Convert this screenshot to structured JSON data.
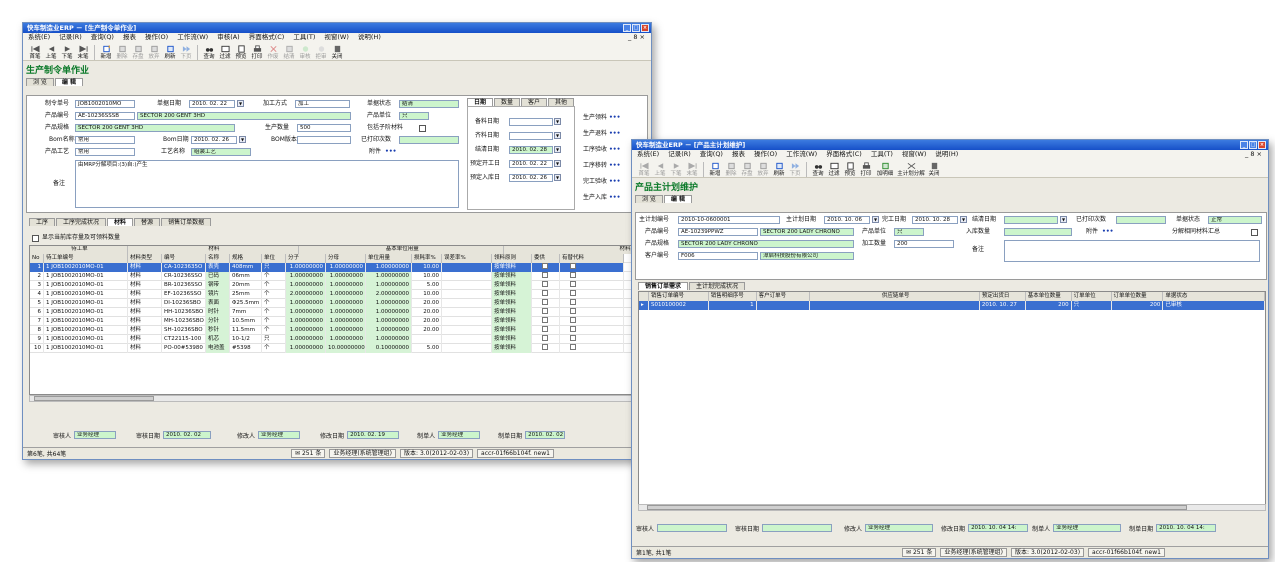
{
  "w1": {
    "title": "快车制造业ERP － [生产制令单作业]",
    "menu": [
      "系统(E)",
      "记录(R)",
      "查询(Q)",
      "报表",
      "操作(O)",
      "工作流(W)",
      "审核(A)",
      "界面格式(C)",
      "工具(T)",
      "视窗(W)",
      "说明(H)"
    ],
    "menu_right": "_ 8 ×",
    "toolbar": [
      "首笔",
      "上笔",
      "下笔",
      "末笔",
      "新增",
      "删除",
      "存盘",
      "放弃",
      "刷新",
      "下页",
      "查询",
      "过滤",
      "预览",
      "打印",
      "作废",
      "结清",
      "审核",
      "拒审",
      "关闭"
    ],
    "form_title": "生产制令单作业",
    "view_tabs": [
      "浏 览",
      "编 辑"
    ],
    "f": {
      "l_no": "制令单号",
      "no": "JOB1002010MO",
      "l_date": "单据日期",
      "date": "2010. 02. 22",
      "l_method": "加工方式",
      "method": "加工",
      "l_status": "单据状态",
      "status": "结清",
      "l_pcode": "产品编号",
      "pcode": "AE-10236SSSB",
      "pname": "SECTOR 200 GENT 3HD",
      "l_unit": "产品单位",
      "unit": "只",
      "l_spec": "产品规格",
      "spec": "SECTOR 200 GENT 3HD",
      "l_qty": "生产数量",
      "qty": "500",
      "l_incl": "包括子阶材料",
      "l_bom": "Bom名称",
      "bom": "常用",
      "l_bomdate": "Bom日期",
      "bomdate": "2010. 02. 26",
      "l_bomver": "BOM版本",
      "l_printed": "已打印次数",
      "l_proc": "产品工艺",
      "proc": "常用",
      "l_procname": "工艺名称",
      "procname": "组装工艺",
      "l_attach": "附件",
      "attach": "•••",
      "memo": "由MRP分解项目:(3)自:)产生",
      "l_memo": "备注"
    },
    "rtabs": [
      "日期",
      "数量",
      "客户",
      "其他"
    ],
    "r": {
      "l_prep": "备料日期",
      "l_reqdate": "齐料日期",
      "l_close": "结清日期",
      "close": "2010. 02. 28",
      "l_pstart": "预定开工日",
      "pstart": "2010. 02. 22",
      "l_pin": "预定入库日",
      "pin": "2010. 02. 26"
    },
    "links": [
      "生产领料",
      "生产退料",
      "工序验收",
      "工序移转",
      "完工验收",
      "生产入库"
    ],
    "link_dots": "•••",
    "btabs": [
      "工序",
      "工序完成状况",
      "材料",
      "替源",
      "销售订单数据"
    ],
    "show_stock": "显示当前库存量及可领料数量",
    "grid_groups": [
      "待工单",
      "材料",
      "基本单位用量",
      "材料其他属"
    ],
    "cols": [
      "No",
      "待工单编号",
      "材料类型",
      "编号",
      "名称",
      "规格",
      "单位",
      "分子",
      "分母",
      "单位用量",
      "损耗率%",
      "误差率%",
      "领料原则",
      "委供",
      "有替代料"
    ],
    "rows": [
      [
        "1",
        "1 JOB1002010MO-01",
        "材料",
        "CA-1023635O",
        "表壳",
        "408mm",
        "只",
        "1.00000000",
        "1.00000000",
        "1.00000000",
        "10.00",
        "",
        "按单领料"
      ],
      [
        "2",
        "1 JOB1002010MO-01",
        "材料",
        "CR-10236SSO",
        "已码",
        "06mm",
        "个",
        "1.00000000",
        "1.00000000",
        "1.00000000",
        "10.00",
        "",
        "按单领料"
      ],
      [
        "3",
        "1 JOB1002010MO-01",
        "材料",
        "BR-10236SSO",
        "钢带",
        "20mm",
        "个",
        "1.00000000",
        "1.00000000",
        "1.00000000",
        "5.00",
        "",
        "按单领料"
      ],
      [
        "4",
        "1 JOB1002010MO-01",
        "材料",
        "EF-10236SSO",
        "镜片",
        "25mm",
        "个",
        "2.00000000",
        "1.00000000",
        "2.00000000",
        "10.00",
        "",
        "按单领料"
      ],
      [
        "5",
        "1 JOB1002010MO-01",
        "材料",
        "DI-10236SBO",
        "表面",
        "Φ25.5mm",
        "个",
        "1.00000000",
        "1.00000000",
        "1.00000000",
        "20.00",
        "",
        "按单领料"
      ],
      [
        "6",
        "1 JOB1002010MO-01",
        "材料",
        "HH-10236SBO",
        "时针",
        "7mm",
        "个",
        "1.00000000",
        "1.00000000",
        "1.00000000",
        "20.00",
        "",
        "按单领料"
      ],
      [
        "7",
        "1 JOB1002010MO-01",
        "材料",
        "MH-10236SBO",
        "分针",
        "10.5mm",
        "个",
        "1.00000000",
        "1.00000000",
        "1.00000000",
        "20.00",
        "",
        "按单领料"
      ],
      [
        "8",
        "1 JOB1002010MO-01",
        "材料",
        "SH-10236SBO",
        "秒针",
        "11.5mm",
        "个",
        "1.00000000",
        "1.00000000",
        "1.00000000",
        "20.00",
        "",
        "按单领料"
      ],
      [
        "9",
        "1 JOB1002010MO-01",
        "材料",
        "CT22115-100",
        "机芯",
        "10-1/2",
        "只",
        "1.00000000",
        "1.00000000",
        "1.00000000",
        "",
        "",
        "按单领料"
      ],
      [
        "10",
        "1 JOB1002010MO-01",
        "材料",
        "PO-00#53980",
        "电池盖",
        "#5398",
        "个",
        "1.00000000",
        "10.00000000",
        "0.10000000",
        "5.00",
        "",
        "按单领料"
      ]
    ],
    "foot": {
      "l_auditor": "审核人",
      "auditor": "业务经理",
      "l_auditdate": "审核日期",
      "auditdate": "2010. 02. 02",
      "l_mod": "修改人",
      "mod": "业务经理",
      "l_moddate": "修改日期",
      "moddate": "2010. 02. 19",
      "l_maker": "制单人",
      "maker": "业务经理",
      "l_makedate": "制单日期",
      "makedate": "2010. 02. 02"
    },
    "status": {
      "left": "第6笔, 共64笔",
      "count": "251 条",
      "user": "业务经理(系统管理组)",
      "ver": "版本: 3.0(2012-02-03)",
      "db": "accr-01f66b104f. new1"
    }
  },
  "w2": {
    "title": "快车制造业ERP － [产品主计划维护]",
    "menu": [
      "系统(E)",
      "记录(R)",
      "查询(Q)",
      "报表",
      "操作(O)",
      "工作流(W)",
      "界面格式(C)",
      "工具(T)",
      "视窗(W)",
      "说明(H)"
    ],
    "menu_right": "_ 8 ×",
    "toolbar": [
      "首笔",
      "上笔",
      "下笔",
      "末笔",
      "新增",
      "删除",
      "存盘",
      "放弃",
      "刷新",
      "下页",
      "查询",
      "过滤",
      "预览",
      "打印",
      "加明细",
      "主计划分解",
      "关闭"
    ],
    "form_title": "产品主计划维护",
    "view_tabs": [
      "浏 览",
      "编 辑"
    ],
    "f": {
      "l_plan": "主计划编号",
      "plan": "2010-10-0600001",
      "l_pdate": "主计划日期",
      "pdate": "2010. 10. 06",
      "l_done": "完工日期",
      "done": "2010. 10. 28",
      "l_close": "结清日期",
      "l_printed": "已打印次数",
      "l_status": "单据状态",
      "status": "正常",
      "l_pcode": "产品编号",
      "pcode": "AE-10239PPWZ",
      "pname": "SECTOR 200 LADY CHRONO",
      "l_unit": "产品单位",
      "unit": "只",
      "l_inqty": "入库数量",
      "l_attach": "附件",
      "attach": "•••",
      "l_merge": "分解相同材料汇总",
      "l_spec": "产品规格",
      "spec": "SECTOR 200 LADY CHRONO",
      "l_qty": "加工数量",
      "qty": "200",
      "l_memo": "备注",
      "l_cust": "客户编号",
      "cust": "F006",
      "custname": "漳启科技股份有限公司"
    },
    "tabs": [
      "销售订单需求",
      "主计划完成状况"
    ],
    "cols": [
      "销售订单编号",
      "销售明细序号",
      "客户订单号",
      "供应链单号",
      "预定出货日",
      "基本单位数量",
      "订单单位",
      "订单单位数量",
      "单据状态"
    ],
    "rows": [
      [
        "S010100002",
        "1",
        "",
        "",
        "2010. 10. 27",
        "200",
        "只",
        "200",
        "已审核"
      ]
    ],
    "foot": {
      "l_auditor": "审核人",
      "l_auditdate": "审核日期",
      "l_mod": "修改人",
      "mod": "业务经理",
      "l_moddate": "修改日期",
      "moddate": "2010. 10. 04 14:",
      "l_maker": "制单人",
      "maker": "业务经理",
      "l_makedate": "制单日期",
      "makedate": "2010. 10. 04 14:"
    },
    "status": {
      "left": "第1笔, 共1笔",
      "count": "251 条",
      "user": "业务经理(系统管理组)",
      "ver": "版本: 3.0(2012-02-03)",
      "db": "accr-01f66b104f. new1"
    }
  },
  "colors": {
    "title": "#1650c8",
    "green_field": "#ccf5cc",
    "selection": "#3a6fd0",
    "form_title": "#0c7a2a"
  }
}
